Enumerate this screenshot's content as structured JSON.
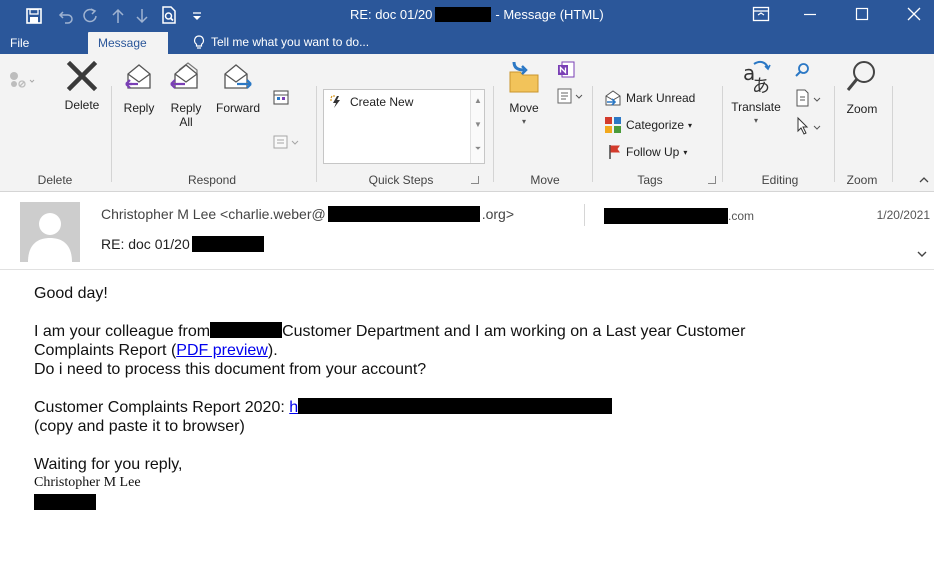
{
  "window": {
    "title_prefix": "RE: doc 01/20",
    "title_suffix": " - Message (HTML)"
  },
  "tabs": {
    "file": "File",
    "message": "Message",
    "tell_me": "Tell me what you want to do..."
  },
  "ribbon": {
    "delete_group": {
      "delete_label": "Delete",
      "group_label": "Delete"
    },
    "respond_group": {
      "reply": "Reply",
      "reply_all_line1": "Reply",
      "reply_all_line2": "All",
      "forward": "Forward",
      "group_label": "Respond"
    },
    "quick_steps": {
      "create_new": "Create New",
      "group_label": "Quick Steps"
    },
    "move_group": {
      "move": "Move",
      "group_label": "Move"
    },
    "tags_group": {
      "mark_unread": "Mark Unread",
      "categorize": "Categorize",
      "follow_up": "Follow Up",
      "group_label": "Tags"
    },
    "editing_group": {
      "translate": "Translate",
      "group_label": "Editing"
    },
    "zoom_group": {
      "zoom": "Zoom",
      "group_label": "Zoom"
    }
  },
  "header": {
    "from_name": "Christopher M Lee <charlie.weber@",
    "from_domain": ".org>",
    "to_suffix": ".com",
    "date": "1/20/2021",
    "subject": "RE: doc 01/20"
  },
  "body": {
    "greeting": "Good day!",
    "p2_line1_a": "I am your colleague from",
    "p2_line1_b": "Customer Department  and I am working on a Last year Customer",
    "p2_line2_a": "Complaints Report (",
    "p2_link": "PDF preview",
    "p2_line2_b": ").",
    "p2_line3": "Do i need to process this document from your account?",
    "p3_line1": "Customer Complaints Report 2020: ",
    "p3_link_start": "h",
    "p3_line2": "(copy and paste it to browser)",
    "closing": "Waiting for you reply,",
    "signature": "Christopher M Lee"
  },
  "colors": {
    "titlebar": "#2b579a",
    "ribbon": "#f3f3f3",
    "link": "#0000ee",
    "accent_purple": "#7a3fb5",
    "accent_blue": "#2b78c5"
  }
}
